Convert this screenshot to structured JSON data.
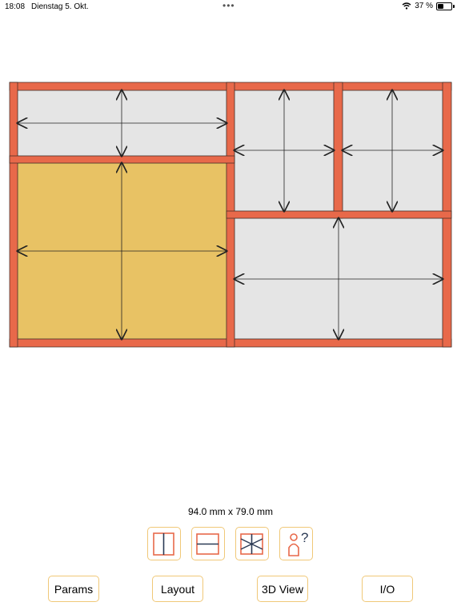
{
  "status_bar": {
    "time": "18:08",
    "date": "Dienstag 5. Okt.",
    "battery": "37 %",
    "battery_level": 0.37,
    "icons": [
      "wifi-icon",
      "battery-icon",
      "multitask-dots-icon"
    ]
  },
  "dimensions_label": "94.0 mm x 79.0 mm",
  "colors": {
    "frame": "#e8694a",
    "panel": "#e5e5e5",
    "selected_panel": "#e8c264",
    "button_border": "#f0c878",
    "icon_red": "#e8694a",
    "icon_navy": "#2b3a55"
  },
  "tools": [
    {
      "name": "vertical-split",
      "icon": "vertical-split-icon"
    },
    {
      "name": "horizontal-split",
      "icon": "horizontal-split-icon"
    },
    {
      "name": "cross-split",
      "icon": "cross-split-icon"
    },
    {
      "name": "help",
      "icon": "help-person-icon",
      "label": "?"
    }
  ],
  "nav": {
    "params": "Params",
    "layout": "Layout",
    "view3d": "3D View",
    "io": "I/O"
  }
}
